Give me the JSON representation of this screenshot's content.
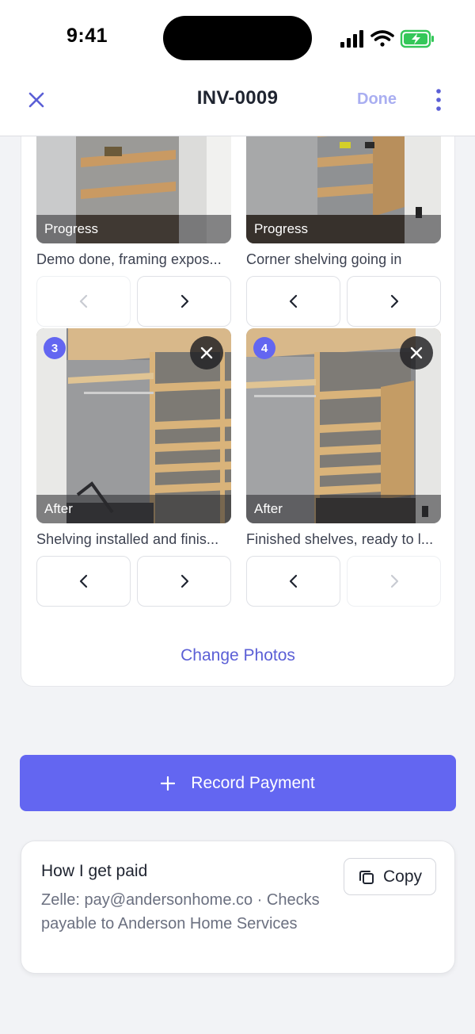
{
  "status_bar": {
    "time": "9:41"
  },
  "header": {
    "title": "INV-0009",
    "done_label": "Done"
  },
  "photos": [
    {
      "number": "",
      "stage": "Progress",
      "caption": "Demo done, framing expos...",
      "prev_enabled": false,
      "next_enabled": true,
      "removable": false
    },
    {
      "number": "",
      "stage": "Progress",
      "caption": "Corner shelving going in",
      "prev_enabled": true,
      "next_enabled": true,
      "removable": false
    },
    {
      "number": "3",
      "stage": "After",
      "caption": "Shelving installed and finis...",
      "prev_enabled": true,
      "next_enabled": true,
      "removable": true
    },
    {
      "number": "4",
      "stage": "After",
      "caption": "Finished shelves, ready to l...",
      "prev_enabled": true,
      "next_enabled": false,
      "removable": true
    }
  ],
  "change_photos_label": "Change Photos",
  "record_payment": {
    "icon": "plus-icon",
    "label": "Record Payment"
  },
  "payment_info": {
    "title": "How I get paid",
    "details": "Zelle: pay@andersonhome.co · Checks payable to Anderson Home Services",
    "copy_label": "Copy"
  },
  "colors": {
    "accent": "#6366f1",
    "done_disabled": "#a9aef1",
    "link": "#5b5fd6"
  }
}
